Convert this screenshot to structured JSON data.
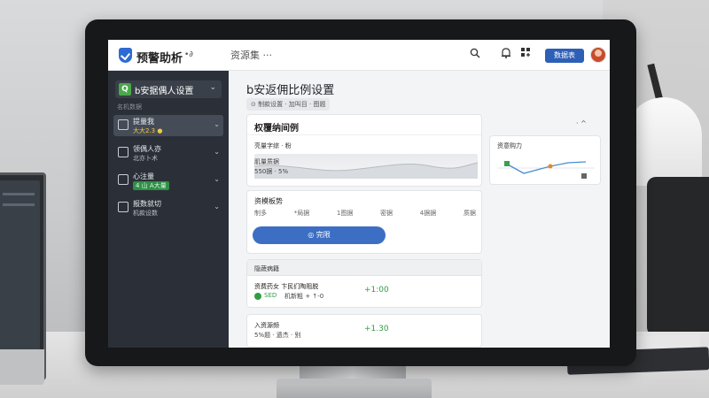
{
  "header": {
    "app_title": "预警助析",
    "app_subtitle": "•∂",
    "app_menu": "资源集 ···",
    "primary_button": "数据表"
  },
  "sidebar": {
    "top_label": "b安据偶人设置",
    "top_icon_letter": "Q",
    "section_label": "名机数据",
    "items": [
      {
        "title": "提量我",
        "sub": "大大2.3 ●"
      },
      {
        "title": "领偶人亦",
        "sub": "北亦卜术"
      },
      {
        "title": "心注量",
        "sub": "4 山 A大量"
      },
      {
        "title": "报数就切",
        "sub": "机款设数"
      }
    ]
  },
  "main": {
    "page_title": "b安返佣比例设置",
    "breadcrumb": "⊙ 制款设置 · 加叫目 · 图题",
    "summary_card": {
      "title": "权覆纳间例",
      "subtitle": "亮量字综 · 粉",
      "stat1": "肌量质据",
      "stat2": "550据 · 5%"
    },
    "collapse_glyphs": "· ^",
    "side_card": {
      "title": "资意购力"
    },
    "form_card": {
      "title": "资模板势",
      "tabs": [
        "制多",
        "*局据",
        "1图据",
        "密据",
        "4据据",
        "质据"
      ],
      "button": "◎ 完限"
    },
    "list_card": {
      "header": "隐蔬病籍",
      "row1": {
        "title": "资费药女 卞民们陶阻脱",
        "status": "SED",
        "detail": "机新粗 + ↑-0",
        "value": "+1:00"
      },
      "row2": {
        "title": "入资源频",
        "detail": "5%题 · 遗杰 · 别",
        "value": "+1.30"
      }
    }
  },
  "colors": {
    "accent": "#2d5fb7",
    "sidebar_bg": "#2b3038",
    "positive": "#2f9e44",
    "warning": "#f0c93e"
  },
  "icons": [
    "shield-logo-icon",
    "search-icon",
    "bell-icon",
    "grid-icon",
    "chevron-down-icon"
  ]
}
